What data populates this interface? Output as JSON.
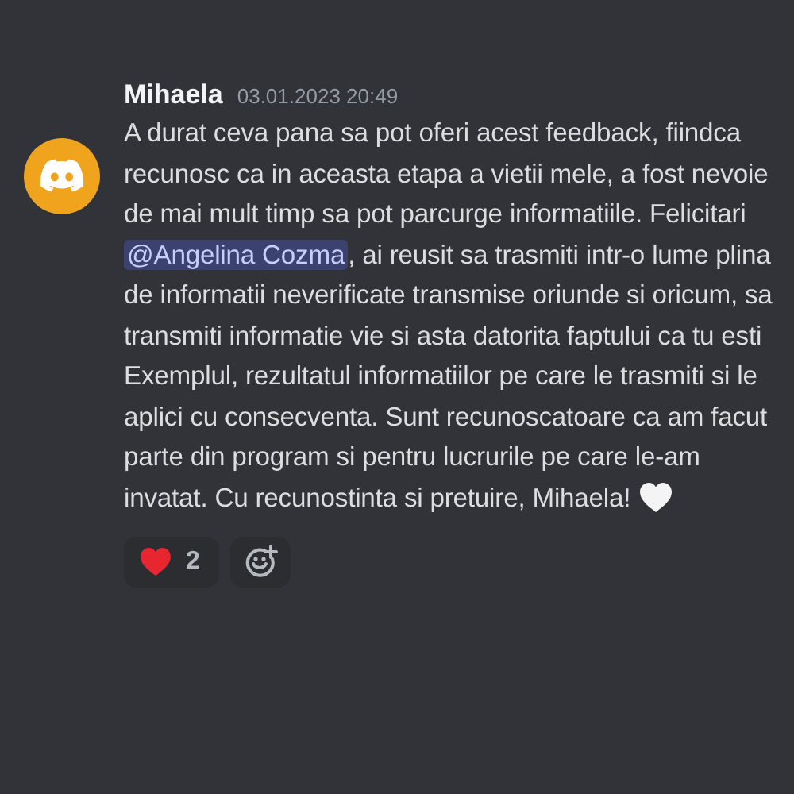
{
  "message": {
    "author": "Mihaela",
    "timestamp": "03.01.2023 20:49",
    "text_before": "A durat ceva pana sa pot oferi acest feedback, fiindca recunosc ca in aceasta etapa a vietii mele, a fost nevoie de mai mult timp sa pot parcurge informatiile. Felicitari ",
    "mention": "@Angelina Cozma",
    "text_after": ", ai reusit sa trasmiti intr-o lume plina de informatii neverificate transmise oriunde si oricum, sa transmiti informatie vie si asta datorita faptului ca tu esti Exemplul, rezultatul informatiilor pe care le trasmiti si le aplici cu consecventa. Sunt recunoscatoare ca am facut parte din program si pentru lucrurile pe care le-am invatat. Cu recunostinta si pretuire, Mihaela!"
  },
  "reactions": [
    {
      "kind": "heart",
      "count": "2"
    }
  ]
}
